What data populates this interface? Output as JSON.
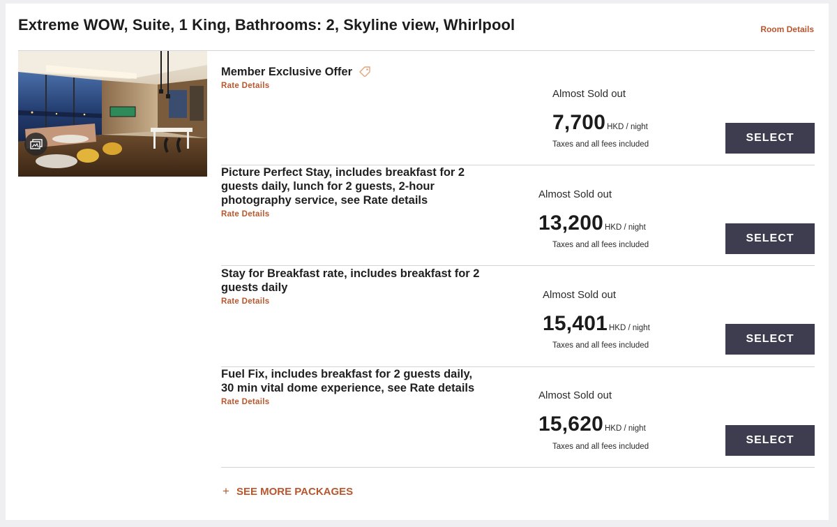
{
  "room": {
    "title": "Extreme WOW, Suite, 1 King, Bathrooms: 2, Skyline view, Whirlpool",
    "details_link": "Room Details",
    "photo_icon": "gallery-icon"
  },
  "rates": [
    {
      "name": "Member Exclusive Offer",
      "tag_icon": "tag-icon",
      "details_link": "Rate Details",
      "availability": "Almost Sold out",
      "price": "7,700",
      "unit": "HKD / night",
      "fees": "Taxes and all fees included",
      "button": "SELECT"
    },
    {
      "name": "Picture Perfect Stay, includes breakfast for 2 guests daily, lunch for 2 guests, 2-hour photography service, see Rate details",
      "details_link": "Rate Details",
      "availability": "Almost Sold out",
      "price": "13,200",
      "unit": "HKD / night",
      "fees": "Taxes and all fees included",
      "button": "SELECT"
    },
    {
      "name": "Stay for Breakfast rate, includes breakfast for 2 guests daily",
      "details_link": "Rate Details",
      "availability": "Almost Sold out",
      "price": "15,401",
      "unit": "HKD / night",
      "fees": "Taxes and all fees included",
      "button": "SELECT"
    },
    {
      "name": "Fuel Fix, includes breakfast for 2 guests daily, 30 min vital dome experience, see Rate details",
      "details_link": "Rate Details",
      "availability": "Almost Sold out",
      "price": "15,620",
      "unit": "HKD / night",
      "fees": "Taxes and all fees included",
      "button": "SELECT"
    }
  ],
  "see_more": {
    "icon": "+",
    "label": "SEE MORE PACKAGES"
  },
  "colors": {
    "accent": "#b8562d",
    "button_bg": "#3e3d4f",
    "page_bg": "#efeff1"
  }
}
